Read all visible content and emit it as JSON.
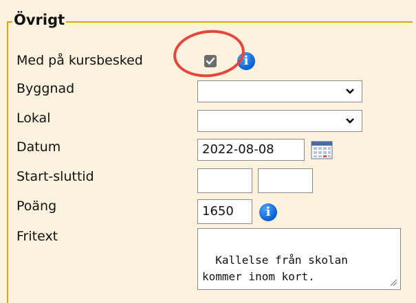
{
  "section": {
    "legend": "Övrigt"
  },
  "fields": {
    "med_pa_kursbesked": {
      "label": "Med på kursbesked",
      "checked": true,
      "info_icon": "info-icon"
    },
    "byggnad": {
      "label": "Byggnad",
      "value": ""
    },
    "lokal": {
      "label": "Lokal",
      "value": ""
    },
    "datum": {
      "label": "Datum",
      "value": "2022-08-08",
      "icon": "calendar-icon"
    },
    "start_sluttid": {
      "label": "Start-sluttid",
      "start": "",
      "end": ""
    },
    "poang": {
      "label": "Poäng",
      "value": "1650",
      "info_icon": "info-icon"
    },
    "fritext": {
      "label": "Fritext",
      "value": "Kallelse från skolan\nkommer inom kort."
    }
  },
  "colors": {
    "background": "#fdf2dd",
    "border_accent": "#e0a400",
    "highlight": "#e8453c",
    "info_blue": "#0b5fd1"
  }
}
